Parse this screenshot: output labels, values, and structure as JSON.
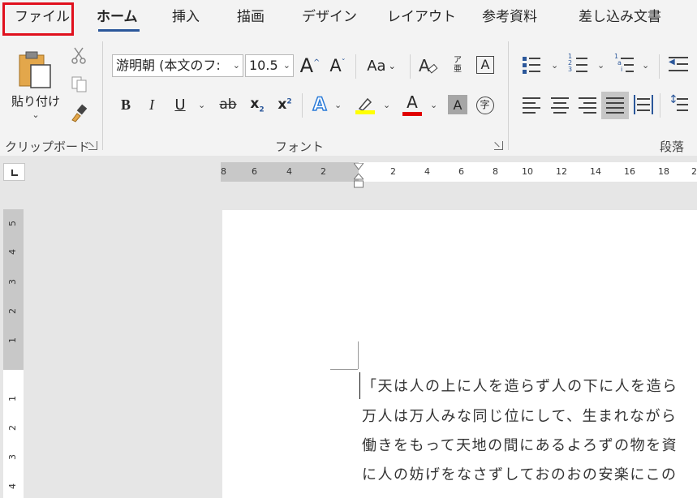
{
  "tabs": [
    {
      "label": "ファイル"
    },
    {
      "label": "ホーム"
    },
    {
      "label": "挿入"
    },
    {
      "label": "描画"
    },
    {
      "label": "デザイン"
    },
    {
      "label": "レイアウト"
    },
    {
      "label": "参考資料"
    },
    {
      "label": "差し込み文書"
    }
  ],
  "ribbon": {
    "clipboard": {
      "label": "クリップボード",
      "paste_label": "貼り付け"
    },
    "font": {
      "label": "フォント",
      "font_name": "游明朝 (本文のフ:",
      "font_size": "10.5",
      "case_label": "Aa"
    },
    "paragraph": {
      "label": "段落"
    }
  },
  "ruler": {
    "h_left": [
      "8",
      "6",
      "4",
      "2"
    ],
    "h_right": [
      "2",
      "4",
      "6",
      "8",
      "10",
      "12",
      "14",
      "16",
      "18",
      "2"
    ],
    "v_top": [
      "5",
      "4",
      "3",
      "2",
      "1"
    ],
    "v_bottom": [
      "1",
      "2",
      "3",
      "4"
    ]
  },
  "document": {
    "lines": [
      "「天は人の上に人を造らず人の下に人を造ら",
      "万人は万人みな同じ位にして、生まれながら",
      "働きをもって天地の間にあるよろずの物を資",
      "に人の妨げをなさずしておのおの安楽にこの"
    ]
  },
  "colors": {
    "accent": "#2b579a",
    "highlight_box": "#e0101d",
    "highlighter": "#ffff00",
    "font_color": "#e00000"
  }
}
